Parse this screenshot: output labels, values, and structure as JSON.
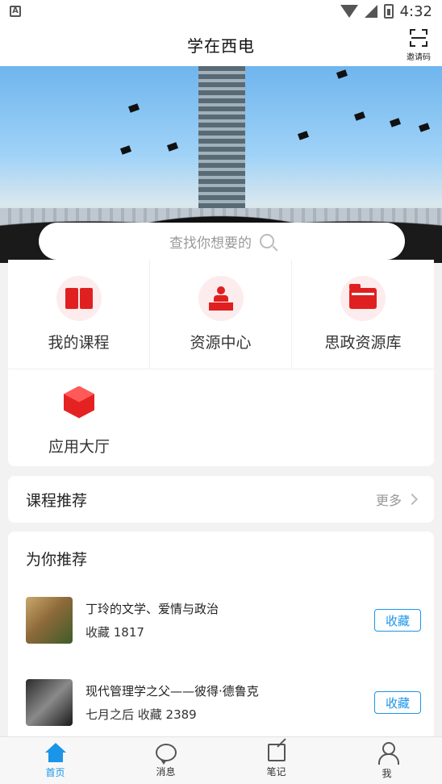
{
  "status": {
    "time": "4:32"
  },
  "header": {
    "title": "学在西电",
    "invite_label": "邀请码"
  },
  "search": {
    "placeholder": "查找你想要的"
  },
  "grid": {
    "items": [
      {
        "label": "我的课程",
        "icon": "book-icon"
      },
      {
        "label": "资源中心",
        "icon": "lecturer-icon"
      },
      {
        "label": "思政资源库",
        "icon": "folder-icon"
      },
      {
        "label": "应用大厅",
        "icon": "cube-icon"
      }
    ]
  },
  "course_recommend": {
    "title": "课程推荐",
    "more_label": "更多"
  },
  "for_you": {
    "title": "为你推荐",
    "items": [
      {
        "name": "丁玲的文学、爱情与政治",
        "meta": "收藏 1817",
        "action": "收藏"
      },
      {
        "name": "现代管理学之父——彼得·德鲁克",
        "meta": "七月之后 收藏 2389",
        "action": "收藏"
      }
    ]
  },
  "tabbar": {
    "items": [
      {
        "label": "首页",
        "active": true
      },
      {
        "label": "消息"
      },
      {
        "label": "笔记"
      },
      {
        "label": "我"
      }
    ],
    "active_color": "#1a95e8"
  },
  "colors": {
    "accent_red": "#e02020",
    "accent_blue": "#1a95e8"
  }
}
